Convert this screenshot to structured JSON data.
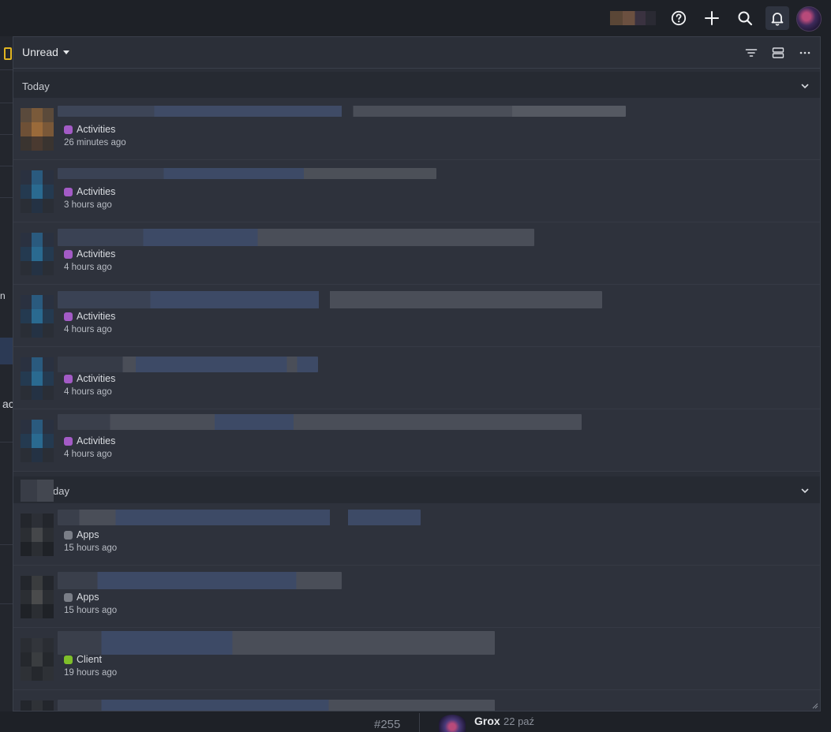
{
  "colors": {
    "activities": "#a35bc6",
    "apps": "#7a7e87",
    "client": "#7fbf2a",
    "panel_bg": "#2b2f38",
    "accent_yellow": "#e0b421"
  },
  "topbar": {
    "icons": [
      "help-icon",
      "plus-icon",
      "search-icon",
      "bell-icon",
      "user-avatar"
    ]
  },
  "panel": {
    "filter_label": "Unread",
    "header_icons": [
      "filter-icon",
      "layout-icon",
      "more-icon"
    ]
  },
  "sections": [
    {
      "title": "Today",
      "items": [
        {
          "category": "Activities",
          "time": "26 minutes ago"
        },
        {
          "category": "Activities",
          "time": "3 hours ago"
        },
        {
          "category": "Activities",
          "time": "4 hours ago"
        },
        {
          "category": "Activities",
          "time": "4 hours ago"
        },
        {
          "category": "Activities",
          "time": "4 hours ago"
        },
        {
          "category": "Activities",
          "time": "4 hours ago"
        }
      ]
    },
    {
      "title": "day",
      "items": [
        {
          "category": "Apps",
          "time": "15 hours ago"
        },
        {
          "category": "Apps",
          "time": "15 hours ago"
        },
        {
          "category": "Client",
          "time": "19 hours ago"
        },
        {
          "category": "",
          "time": ""
        }
      ]
    }
  ],
  "background": {
    "fragment_1": "n",
    "fragment_2": "ac",
    "issue_number": "#255",
    "author": "Grox",
    "date": "22 paź"
  }
}
